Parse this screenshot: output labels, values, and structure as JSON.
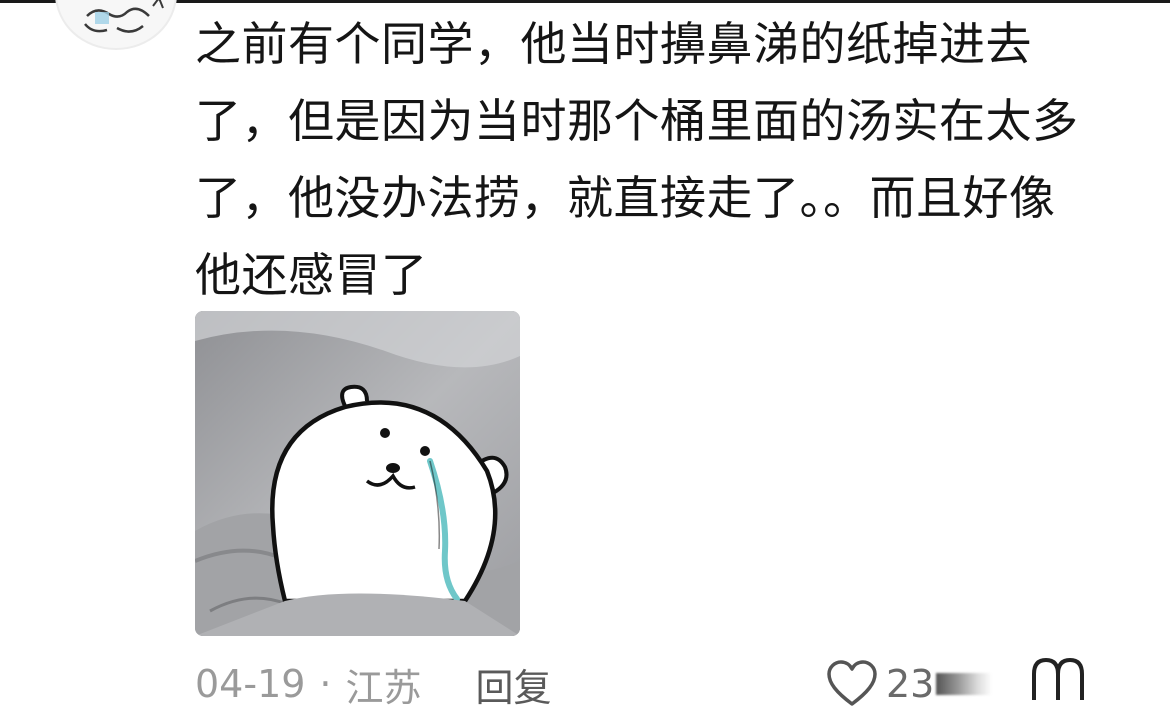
{
  "comment": {
    "text": "之前有个同学，他当时擤鼻涕的纸掉进去了，但是因为当时那个桶里面的汤实在太多了，他没办法捞，就直接走了。。而且好像他还感冒了",
    "image_icon": "crying-bear-sticker"
  },
  "meta": {
    "date": "04-19",
    "separator": "·",
    "location": "江苏",
    "reply_label": "回复",
    "like_count_visible": "23"
  },
  "icons": {
    "avatar": "cartoon-avatar",
    "like": "heart-outline-icon",
    "more": "more-icon"
  },
  "colors": {
    "text": "#151515",
    "meta": "#9a9a9a",
    "tear": "#6fc7c9"
  }
}
